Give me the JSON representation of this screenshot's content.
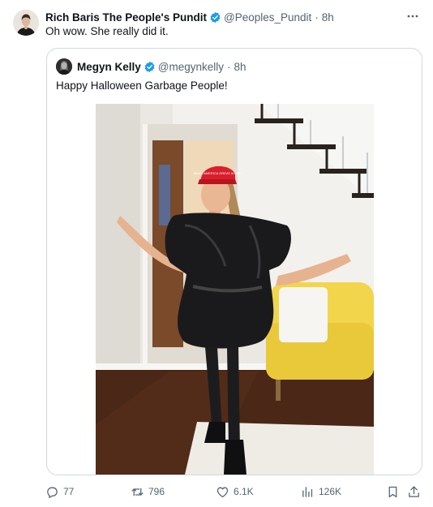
{
  "tweet": {
    "author_name": "Rich Baris The People's Pundit",
    "handle": "@Peoples_Pundit",
    "separator": "·",
    "time": "8h",
    "text": "Oh wow. She really did it."
  },
  "quote": {
    "author_name": "Megyn Kelly",
    "handle": "@megynkelly",
    "separator": "·",
    "time": "8h",
    "text": "Happy Halloween Garbage People!",
    "hat_text": "MAKE AMERICA GREAT AGAIN"
  },
  "actions": {
    "replies": "77",
    "reposts": "796",
    "likes": "6.1K",
    "views": "126K"
  },
  "icons": {
    "verified": "verified-badge-icon",
    "more": "more-dots-icon",
    "reply": "reply-icon",
    "repost": "repost-icon",
    "like": "like-icon",
    "views": "views-icon",
    "bookmark": "bookmark-icon",
    "share": "share-icon"
  },
  "colors": {
    "verified_blue": "#1d9bf0",
    "muted_text": "#536471",
    "border": "#cfd9de"
  }
}
